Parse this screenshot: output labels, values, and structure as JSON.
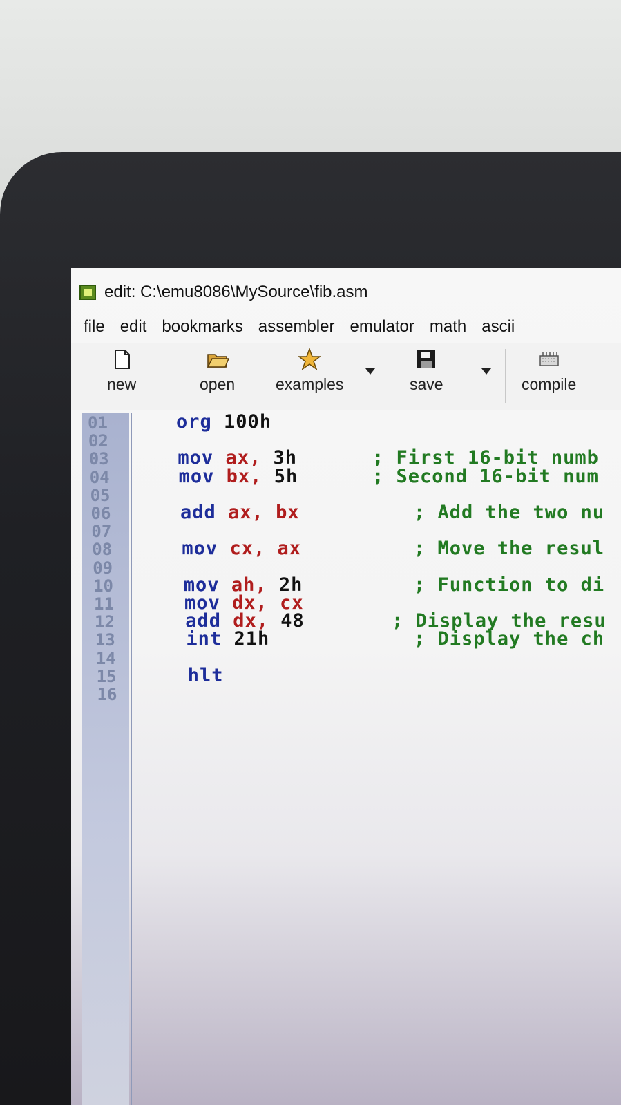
{
  "window": {
    "title": "edit: C:\\emu8086\\MySource\\fib.asm"
  },
  "menu": {
    "items": [
      "file",
      "edit",
      "bookmarks",
      "assembler",
      "emulator",
      "math",
      "ascii"
    ]
  },
  "toolbar": {
    "new_label": "new",
    "open_label": "open",
    "examples_label": "examples",
    "save_label": "save",
    "compile_label": "compile"
  },
  "editor": {
    "line_numbers": [
      "01",
      "02",
      "03",
      "04",
      "05",
      "06",
      "07",
      "08",
      "09",
      "10",
      "11",
      "12",
      "13",
      "14",
      "15",
      "16"
    ],
    "lines": [
      {
        "n": "01",
        "op": "org",
        "args": [
          {
            "t": "100h",
            "c": "num"
          }
        ],
        "comment": ""
      },
      {
        "n": "02",
        "op": "",
        "args": [],
        "comment": ""
      },
      {
        "n": "03",
        "op": "mov",
        "args": [
          {
            "t": "ax,",
            "c": "reg"
          },
          {
            "t": "3h",
            "c": "num"
          }
        ],
        "comment": "; First 16-bit numb"
      },
      {
        "n": "04",
        "op": "mov",
        "args": [
          {
            "t": "bx,",
            "c": "reg"
          },
          {
            "t": "5h",
            "c": "num"
          }
        ],
        "comment": "; Second 16-bit num"
      },
      {
        "n": "05",
        "op": "",
        "args": [],
        "comment": ""
      },
      {
        "n": "06",
        "op": "add",
        "args": [
          {
            "t": "ax,",
            "c": "reg"
          },
          {
            "t": "bx",
            "c": "reg"
          }
        ],
        "comment": "; Add the two nu"
      },
      {
        "n": "07",
        "op": "",
        "args": [],
        "comment": ""
      },
      {
        "n": "08",
        "op": "mov",
        "args": [
          {
            "t": "cx,",
            "c": "reg"
          },
          {
            "t": "ax",
            "c": "reg"
          }
        ],
        "comment": "; Move the resul"
      },
      {
        "n": "09",
        "op": "",
        "args": [],
        "comment": ""
      },
      {
        "n": "10",
        "op": "mov",
        "args": [
          {
            "t": "ah,",
            "c": "reg"
          },
          {
            "t": "2h",
            "c": "num"
          }
        ],
        "comment": "; Function to di"
      },
      {
        "n": "11",
        "op": "mov",
        "args": [
          {
            "t": "dx,",
            "c": "reg"
          },
          {
            "t": "cx",
            "c": "reg"
          }
        ],
        "comment": ""
      },
      {
        "n": "12",
        "op": "add",
        "args": [
          {
            "t": "dx,",
            "c": "reg"
          },
          {
            "t": "48",
            "c": "num"
          }
        ],
        "comment": "; Display the resu"
      },
      {
        "n": "13",
        "op": "int",
        "args": [
          {
            "t": "21h",
            "c": "num"
          }
        ],
        "comment": "; Display the ch"
      },
      {
        "n": "14",
        "op": "",
        "args": [],
        "comment": ""
      },
      {
        "n": "15",
        "op": "hlt",
        "args": [],
        "comment": ""
      },
      {
        "n": "16",
        "op": "",
        "args": [],
        "comment": ""
      }
    ]
  },
  "colors": {
    "keyword": "#1d2d9a",
    "register": "#b01d1d",
    "comment": "#227a22",
    "gutter": "#a9b2cf"
  }
}
